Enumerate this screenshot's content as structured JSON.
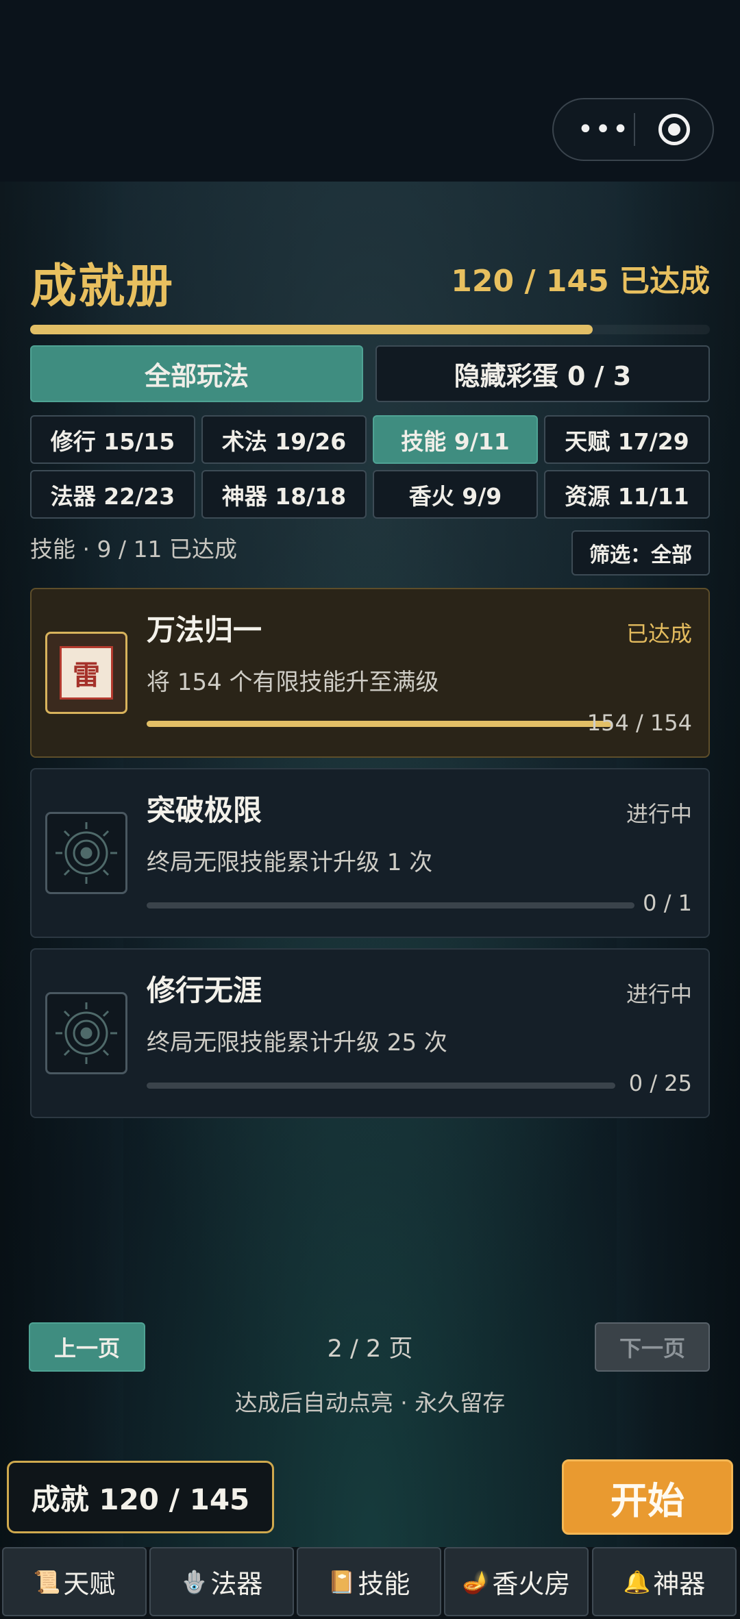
{
  "header": {
    "title": "成就册",
    "progress_text": "120 / 145 已达成",
    "progress_fraction": 0.828
  },
  "capsule": {
    "more_label": "•••",
    "more_icon": "more-dots-icon",
    "close_icon": "target-circle-icon"
  },
  "mode_tabs": [
    {
      "label": "全部玩法",
      "active": true
    },
    {
      "label": "隐藏彩蛋 0 / 3",
      "active": false
    }
  ],
  "categories": [
    {
      "label": "修行 15/15",
      "active": false
    },
    {
      "label": "术法 19/26",
      "active": false
    },
    {
      "label": "技能 9/11",
      "active": true
    },
    {
      "label": "天赋 17/29",
      "active": false
    },
    {
      "label": "法器 22/23",
      "active": false
    },
    {
      "label": "神器 18/18",
      "active": false
    },
    {
      "label": "香火 9/9",
      "active": false
    },
    {
      "label": "资源 11/11",
      "active": false
    }
  ],
  "summary": "技能 · 9 / 11 已达成",
  "filter_label": "筛选：全部",
  "achievements": [
    {
      "title": "万法归一",
      "status": "已达成",
      "desc": "将 154 个有限技能升至满级",
      "progress": "154 / 154",
      "fraction": 1.0,
      "icon": "thunder-seal-icon",
      "icon_char": "雷",
      "done": true
    },
    {
      "title": "突破极限",
      "status": "进行中",
      "desc": "终局无限技能累计升级 1 次",
      "progress": "0 / 1",
      "fraction": 0,
      "icon": "locked-medallion-icon",
      "done": false
    },
    {
      "title": "修行无涯",
      "status": "进行中",
      "desc": "终局无限技能累计升级 25 次",
      "progress": "0 / 25",
      "fraction": 0,
      "icon": "locked-medallion-icon",
      "done": false
    }
  ],
  "pagination": {
    "prev": "上一页",
    "indicator": "2 / 2 页",
    "next": "下一页"
  },
  "hint": "达成后自动点亮 · 永久留存",
  "achievement_button": "成就 120 / 145",
  "start_button": "开始",
  "bottom_tabs": [
    {
      "label": "天赋",
      "icon": "scroll-icon",
      "glyph": "📜"
    },
    {
      "label": "法器",
      "icon": "gourd-icon",
      "glyph": "🪬"
    },
    {
      "label": "技能",
      "icon": "book-icon",
      "glyph": "📔"
    },
    {
      "label": "香火房",
      "icon": "incense-icon",
      "glyph": "🪔"
    },
    {
      "label": "神器",
      "icon": "bell-icon",
      "glyph": "🔔"
    }
  ],
  "colors": {
    "accent_gold": "#e2bf66",
    "accent_teal": "#3f8d80",
    "start_orange": "#e99a30"
  }
}
